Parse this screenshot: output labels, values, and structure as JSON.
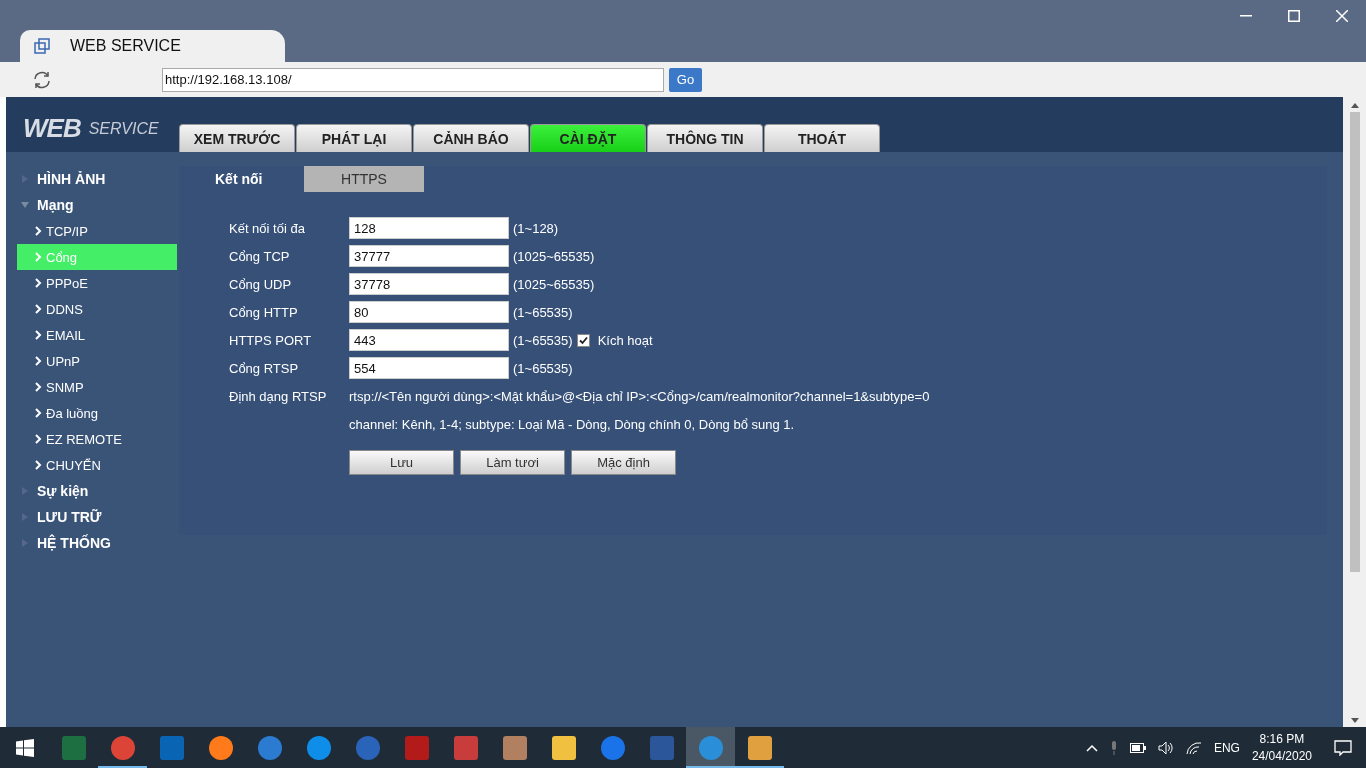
{
  "browser": {
    "tab_title": "WEB SERVICE",
    "url": "http://192.168.13.108/",
    "go_button": "Go"
  },
  "header": {
    "logo_main": "WEB",
    "logo_sub": "SERVICE",
    "nav": [
      {
        "label": "XEM TRƯỚC",
        "selected": false
      },
      {
        "label": "PHÁT LẠI",
        "selected": false
      },
      {
        "label": "CẢNH BÁO",
        "selected": false
      },
      {
        "label": "CÀI ĐẶT",
        "selected": true
      },
      {
        "label": "THÔNG TIN",
        "selected": false
      },
      {
        "label": "THOÁT",
        "selected": false
      }
    ]
  },
  "sidebar": {
    "items": [
      {
        "label": "HÌNH ẢNH",
        "expanded": false
      },
      {
        "label": "Mạng",
        "expanded": true,
        "children": [
          {
            "label": "TCP/IP",
            "selected": false
          },
          {
            "label": "Cổng",
            "selected": true
          },
          {
            "label": "PPPoE",
            "selected": false
          },
          {
            "label": "DDNS",
            "selected": false
          },
          {
            "label": "EMAIL",
            "selected": false
          },
          {
            "label": "UPnP",
            "selected": false
          },
          {
            "label": "SNMP",
            "selected": false
          },
          {
            "label": "Đa luồng",
            "selected": false
          },
          {
            "label": "EZ REMOTE",
            "selected": false
          },
          {
            "label": "CHUYỂN",
            "selected": false
          }
        ]
      },
      {
        "label": "Sự kiện",
        "expanded": false
      },
      {
        "label": "LƯU TRỮ",
        "expanded": false
      },
      {
        "label": "HỆ THỐNG",
        "expanded": false
      }
    ]
  },
  "panel": {
    "tabs": [
      {
        "label": "Kết nối",
        "selected": true
      },
      {
        "label": "HTTPS",
        "selected": false
      }
    ],
    "fields": [
      {
        "label": "Kết nối tối đa",
        "value": "128",
        "range": "(1~128)"
      },
      {
        "label": "Cổng TCP",
        "value": "37777",
        "range": "(1025~65535)"
      },
      {
        "label": "Cổng UDP",
        "value": "37778",
        "range": "(1025~65535)"
      },
      {
        "label": "Cổng HTTP",
        "value": "80",
        "range": "(1~65535)"
      },
      {
        "label": "HTTPS PORT",
        "value": "443",
        "range": "(1~65535)",
        "checkbox": {
          "label": "Kích hoạt",
          "checked": true
        }
      },
      {
        "label": "Cổng RTSP",
        "value": "554",
        "range": "(1~65535)"
      }
    ],
    "rtsp_label": "Định dạng RTSP",
    "rtsp_format": "rtsp://<Tên người dùng>:<Mật khẩu>@<Địa chỉ IP>:<Cổng>/cam/realmonitor?channel=1&subtype=0",
    "rtsp_note": "channel: Kênh, 1-4; subtype: Loại Mã - Dòng, Dòng chính 0, Dòng bổ sung 1.",
    "buttons": [
      "Lưu",
      "Làm tươi",
      "Mặc định"
    ]
  },
  "taskbar": {
    "apps": [
      {
        "kind": "spreadsheet",
        "color": "#1d6f42",
        "running": false,
        "selected": false
      },
      {
        "kind": "browser",
        "color": "#db4437",
        "running": true,
        "selected": false
      },
      {
        "kind": "mail",
        "color": "#0a64b4",
        "running": false,
        "selected": false
      },
      {
        "kind": "browser",
        "color": "#ff7a1a",
        "running": false,
        "selected": false
      },
      {
        "kind": "monitor",
        "color": "#2b7bd1",
        "running": false,
        "selected": false
      },
      {
        "kind": "arrows",
        "color": "#0e8ee9",
        "running": false,
        "selected": false
      },
      {
        "kind": "disc",
        "color": "#2a64b8",
        "running": false,
        "selected": false
      },
      {
        "kind": "triangle",
        "color": "#b31b1b",
        "running": false,
        "selected": false
      },
      {
        "kind": "tiles",
        "color": "#c83c3c",
        "running": false,
        "selected": false
      },
      {
        "kind": "photo",
        "color": "#b08060",
        "running": false,
        "selected": false
      },
      {
        "kind": "folder",
        "color": "#f0c040",
        "running": false,
        "selected": false
      },
      {
        "kind": "chat",
        "color": "#1a73e8",
        "running": false,
        "selected": false
      },
      {
        "kind": "document",
        "color": "#2b579a",
        "running": false,
        "selected": false
      },
      {
        "kind": "camera",
        "color": "#2a8fd8",
        "running": true,
        "selected": true
      },
      {
        "kind": "palette",
        "color": "#e0a040",
        "running": true,
        "selected": false
      }
    ],
    "language": "ENG",
    "time": "8:16 PM",
    "date": "24/04/2020"
  }
}
